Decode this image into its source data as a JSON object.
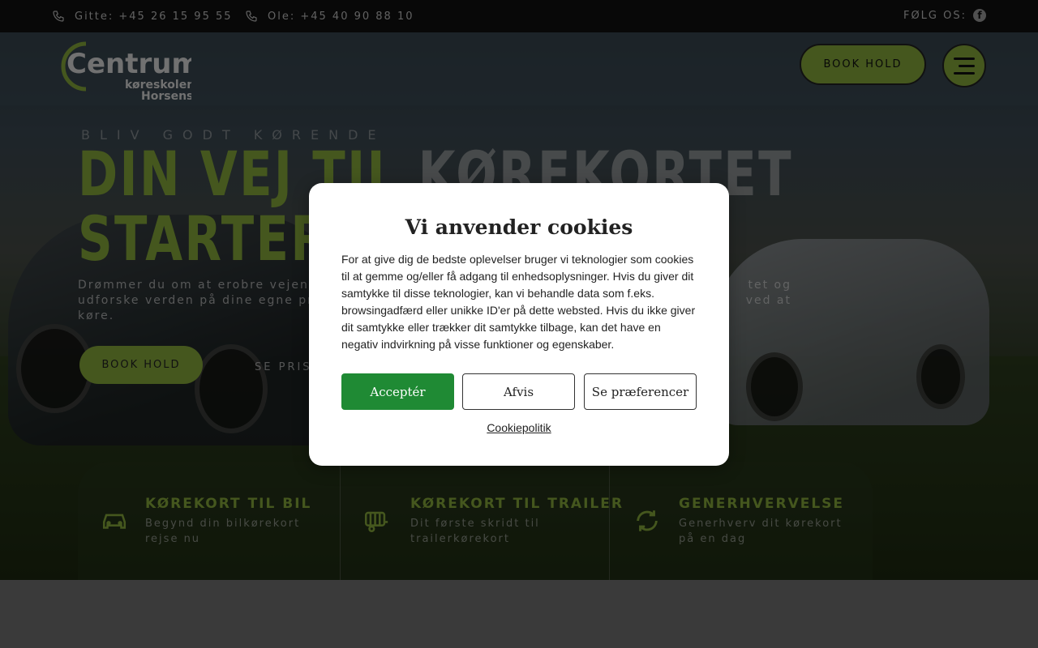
{
  "topbar": {
    "phone1": "Gitte: +45 26 15 95 55",
    "phone2": "Ole: +45 40 90 88 10",
    "follow_label": "FØLG OS:",
    "social_icon": "facebook-icon"
  },
  "header": {
    "logo_word": "Centrum",
    "logo_line1": "køreskolen",
    "logo_line2": "Horsens",
    "book_label": "BOOK HOLD",
    "menu_icon": "hamburger-menu-icon"
  },
  "hero": {
    "tagline": "BLIV GODT KØRENDE",
    "headline_green_1": "DIN VEJ TIL",
    "headline_grey": "KØREKORTET",
    "headline_green_2": "STARTER",
    "lead": "Drømmer du om at erobre vejene ... tet og udforske verden på dine egne pro... ved at køre.",
    "lead_left_1": "Drømmer du om at erobre vejene",
    "lead_left_2": "udforske verden på dine egne pro",
    "lead_left_3": "køre.",
    "lead_right_1": "tet og",
    "lead_right_2": "ved at",
    "book_label": "BOOK HOLD",
    "see_prices_label": "SE PRISE"
  },
  "cards": [
    {
      "title": "KØREKORT TIL BIL",
      "subtitle_1": "Begynd din bilkørekort",
      "subtitle_2": "rejse nu",
      "icon": "car-icon"
    },
    {
      "title": "KØREKORT TIL TRAILER",
      "subtitle_1": "Dit første skridt til",
      "subtitle_2": "trailerkørekort",
      "icon": "trailer-icon"
    },
    {
      "title": "GENERHVERVELSE",
      "subtitle_1": "Generhverv dit kørekort",
      "subtitle_2": "på en dag",
      "icon": "refresh-icon"
    }
  ],
  "cookie_modal": {
    "title": "Vi anvender cookies",
    "body": "For at give dig de bedste oplevelser bruger vi teknologier som cookies til at gemme og/eller få adgang til enhedsoplysninger. Hvis du giver dit samtykke til disse teknologier, kan vi behandle data som f.eks. browsingadfærd eller unikke ID'er på dette websted. Hvis du ikke giver dit samtykke eller trækker dit samtykke tilbage, kan det have en negativ indvirkning på visse funktioner og egenskaber.",
    "accept_label": "Acceptér",
    "reject_label": "Afvis",
    "preferences_label": "Se præferencer",
    "policy_label": "Cookiepolitik"
  },
  "colors": {
    "accent": "#84a73a",
    "accept_button": "#1f8a34",
    "topbar": "#101010"
  }
}
